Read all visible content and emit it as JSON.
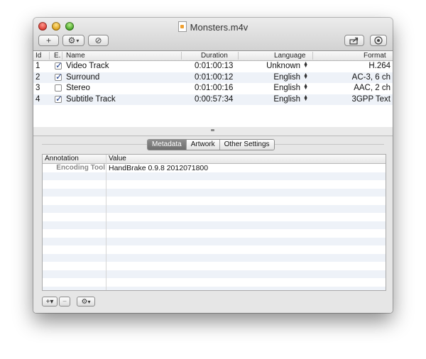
{
  "window": {
    "title": "Monsters.m4v"
  },
  "toolbar": {
    "add_label": "+",
    "gear_arrow": "▾",
    "cancel_icon": "⊘"
  },
  "tracks": {
    "columns": [
      "Id",
      "E.",
      "Name",
      "Duration",
      "Language",
      "Format"
    ],
    "rows": [
      {
        "id": "1",
        "enabled": true,
        "name": "Video Track",
        "duration": "0:01:00:13",
        "language": "Unknown",
        "format": "H.264"
      },
      {
        "id": "2",
        "enabled": true,
        "name": "Surround",
        "duration": "0:01:00:12",
        "language": "English",
        "format": "AC-3, 6 ch"
      },
      {
        "id": "3",
        "enabled": false,
        "name": "Stereo",
        "duration": "0:01:00:16",
        "language": "English",
        "format": "AAC, 2 ch"
      },
      {
        "id": "4",
        "enabled": true,
        "name": "Subtitle Track",
        "duration": "0:00:57:34",
        "language": "English",
        "format": "3GPP Text"
      }
    ]
  },
  "tabs": [
    "Metadata",
    "Artwork",
    "Other Settings"
  ],
  "active_tab": "Metadata",
  "metadata": {
    "columns": [
      "Annotation",
      "Value"
    ],
    "rows": [
      {
        "annotation": "Encoding Tool",
        "value": "HandBrake 0.9.8 2012071800"
      }
    ]
  },
  "bottom": {
    "add_label": "+▾",
    "remove_label": "−",
    "gear_arrow": "▾"
  },
  "colors": {
    "alt_row": "#eef2f8",
    "active_tab": "#7a7a7a",
    "check": "#1e3e8c"
  }
}
